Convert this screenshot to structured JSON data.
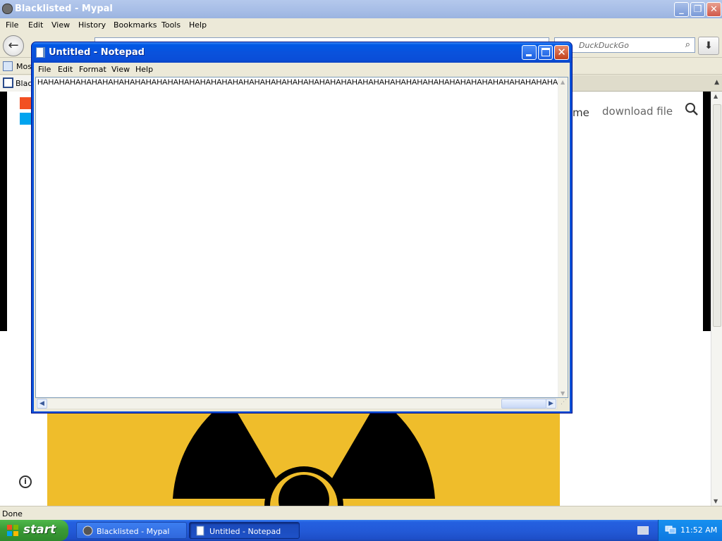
{
  "browser": {
    "title": "Blacklisted - Mypal",
    "menu": [
      "File",
      "Edit",
      "View",
      "History",
      "Bookmarks",
      "Tools",
      "Help"
    ],
    "search_placeholder": "DuckDuckGo",
    "bookmark_label": "Most",
    "tab_label": "Black",
    "status": "Done",
    "content": {
      "nav_partial": "me",
      "nav_download": "download file"
    }
  },
  "notepad": {
    "title": "Untitled - Notepad",
    "menu": [
      "File",
      "Edit",
      "Format",
      "View",
      "Help"
    ],
    "text": "HAHAHAHAHAHAHAHAHAHAHAHAHAHAHAHAHAHAHAHAHAHAHAHAHAHAHAHAHAHAHAHAHAHAHAHAHAHAHAHAHAHAHAHAHAHAHAHAHA"
  },
  "taskbar": {
    "start_label": "start",
    "tasks": [
      {
        "label": "Blacklisted - Mypal",
        "active": false
      },
      {
        "label": "Untitled - Notepad",
        "active": true
      }
    ],
    "clock": "11:52 AM"
  },
  "colors": {
    "xp_blue": "#0a52dc",
    "hazard_yellow": "#efbd2b",
    "start_green": "#3a9a36"
  }
}
